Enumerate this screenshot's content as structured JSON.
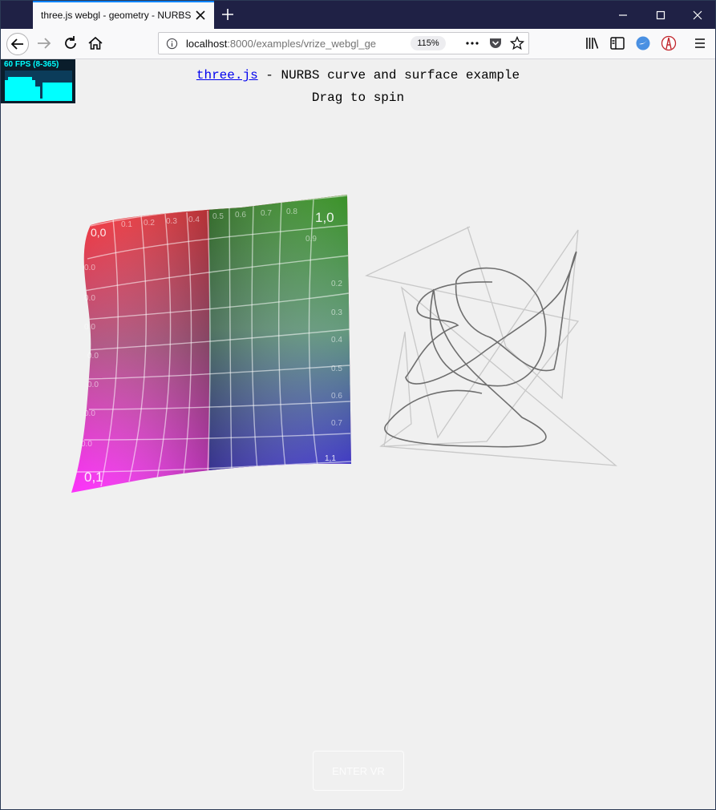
{
  "browser": {
    "tab_title": "three.js webgl - geometry - NURBS",
    "url_host": "localhost",
    "url_rest": ":8000/examples/vrize_webgl_ge",
    "zoom": "115%"
  },
  "page": {
    "link_text": "three.js",
    "subtitle": " - NURBS curve and surface example",
    "instruction": "Drag to spin",
    "stats": "60 FPS (8-365)",
    "vr_button": "ENTER VR"
  },
  "surface_labels": {
    "top_left": "0,0",
    "top_right": "1,0",
    "bottom_left": "0,1",
    "bottom_right": "1,1",
    "left_column": [
      "0.0",
      "0.0",
      "0.0",
      "0.0",
      "0.0",
      "0.0",
      "0.0"
    ],
    "top_row": [
      "0.1",
      "0.2",
      "0.3",
      "0.4",
      "0.5",
      "0.6",
      "0.7",
      "0.8"
    ],
    "right_column": [
      "0.9",
      "0.2",
      "0.3",
      "0.4",
      "0.5",
      "0.6",
      "0.7"
    ]
  },
  "colors": {
    "titlebar": "#1f2145",
    "accent": "#0a84ff",
    "stats_fg": "#00ffff",
    "stats_bg": "#0a1d2b",
    "link": "#0000ee"
  }
}
